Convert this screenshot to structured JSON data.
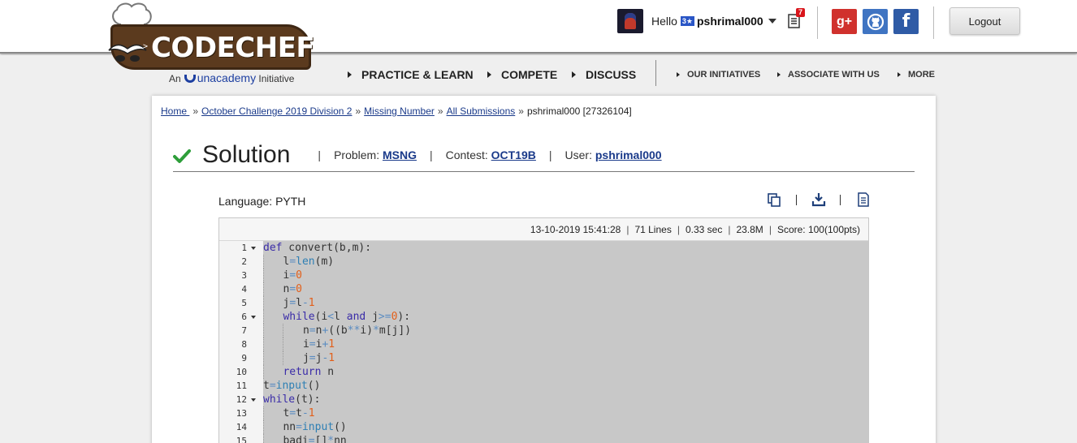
{
  "header": {
    "logo": {
      "wordmark": "CODECHEF",
      "tagline_prefix": "An",
      "tagline_brand": "unacademy",
      "tagline_suffix": "Initiative"
    },
    "user": {
      "greeting": "Hello",
      "rating_stars": "3★",
      "username": "pshrimal000"
    },
    "notifications": {
      "count": "7"
    },
    "social": {
      "google_plus": "g+",
      "facebook": "f"
    },
    "logout_label": "Logout"
  },
  "nav": {
    "main": [
      "PRACTICE & LEARN",
      "COMPETE",
      "DISCUSS"
    ],
    "secondary": [
      "OUR INITIATIVES",
      "ASSOCIATE WITH US",
      "MORE"
    ]
  },
  "breadcrumb": {
    "items": [
      "Home ",
      "October Challenge 2019 Division 2",
      "Missing Number",
      "All Submissions"
    ],
    "current": "pshrimal000 [27326104]",
    "separator": "»"
  },
  "solution": {
    "title": "Solution",
    "problem_label": "Problem:",
    "problem_code": "MSNG",
    "contest_label": "Contest:",
    "contest_code": "OCT19B",
    "user_label": "User:",
    "user_name": "pshrimal000",
    "separator": "|"
  },
  "language": "Language: PYTH",
  "stats": {
    "datetime": "13-10-2019 15:41:28",
    "lines": "71 Lines",
    "time": "0.33 sec",
    "memory": "23.8M",
    "score": "Score: 100(100pts)"
  },
  "code": {
    "line_numbers": [
      "1",
      "2",
      "3",
      "4",
      "5",
      "6",
      "7",
      "8",
      "9",
      "10",
      "11",
      "12",
      "13",
      "14",
      "15"
    ],
    "foldable_lines": [
      1,
      6,
      12
    ]
  },
  "colors": {
    "link": "#1a3a8a",
    "check_green": "#2e9e3a",
    "keyword": "#3a2ca8",
    "builtin": "#2e7fb4",
    "number": "#e25f1a",
    "code_selection_bg": "#c8c8c8"
  },
  "icons": [
    "copy-icon",
    "download-icon",
    "document-icon",
    "check-icon",
    "notification-icon",
    "github-icon"
  ]
}
